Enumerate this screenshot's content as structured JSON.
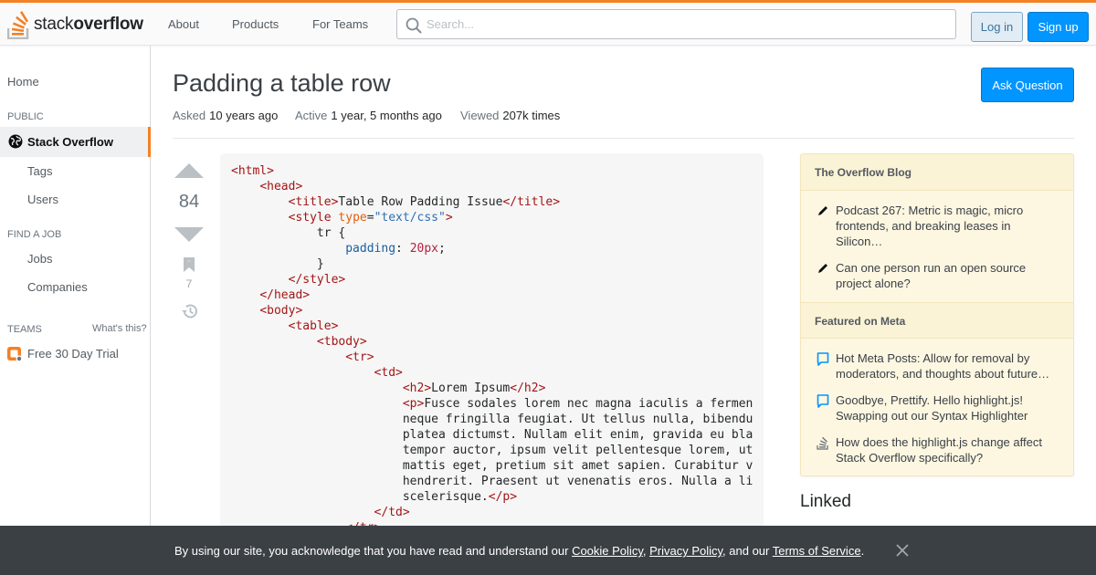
{
  "header": {
    "logo_text_light": "stack",
    "logo_text_bold": "overflow",
    "nav": {
      "about": "About",
      "products": "Products",
      "for_teams": "For Teams"
    },
    "search_placeholder": "Search...",
    "login": "Log in",
    "signup": "Sign up",
    "accent": "#f48024"
  },
  "leftnav": {
    "home": "Home",
    "public_heading": "PUBLIC",
    "stack_overflow": "Stack Overflow",
    "tags": "Tags",
    "users": "Users",
    "find_job_heading": "FIND A JOB",
    "jobs": "Jobs",
    "companies": "Companies",
    "teams_heading": "TEAMS",
    "whats_this": "What's this?",
    "free_trial": "Free 30 Day Trial"
  },
  "question": {
    "title": "Padding a table row",
    "ask_button": "Ask Question",
    "asked_label": "Asked",
    "asked_value": "10 years ago",
    "active_label": "Active",
    "active_value": "1 year, 5 months ago",
    "viewed_label": "Viewed",
    "viewed_value": "207k times",
    "votes": "84",
    "bookmarks": "7"
  },
  "code_lines": [
    "<html>",
    "    <head>",
    "        <title>Table Row Padding Issue</title>",
    "        <style type=\"text/css\">",
    "            tr {",
    "                padding: 20px;",
    "            }",
    "        </style>",
    "    </head>",
    "    <body>",
    "        <table>",
    "            <tbody>",
    "                <tr>",
    "                    <td>",
    "                        <h2>Lorem Ipsum</h2>",
    "                        <p>Fusce sodales lorem nec magna iaculis a fermen",
    "                        neque fringilla feugiat. Ut tellus nulla, bibendu",
    "                        platea dictumst. Nullam elit enim, gravida eu bla",
    "                        tempor auctor, ipsum velit pellentesque lorem, ut",
    "                        mattis eget, pretium sit amet sapien. Curabitur v",
    "                        hendrerit. Praesent ut venenatis eros. Nulla a li",
    "                        scelerisque.</p>",
    "                    </td>",
    "                </tr>"
  ],
  "sidebar": {
    "blog_heading": "The Overflow Blog",
    "blog_items": [
      "Podcast 267: Metric is magic, micro frontends, and breaking leases in Silicon…",
      "Can one person run an open source project alone?"
    ],
    "meta_heading": "Featured on Meta",
    "meta_items": [
      "Hot Meta Posts: Allow for removal by moderators, and thoughts about future…",
      "Goodbye, Prettify. Hello highlight.js! Swapping out our Syntax Highlighter",
      "How does the highlight.js change affect Stack Overflow specifically?"
    ],
    "linked_heading": "Linked"
  },
  "cookie": {
    "text_1": "By using our site, you acknowledge that you have read and understand our ",
    "cookie_policy": "Cookie Policy",
    "sep_1": ", ",
    "privacy_policy": "Privacy Policy",
    "text_2": ", and our ",
    "terms": "Terms of Service",
    "text_3": "."
  }
}
